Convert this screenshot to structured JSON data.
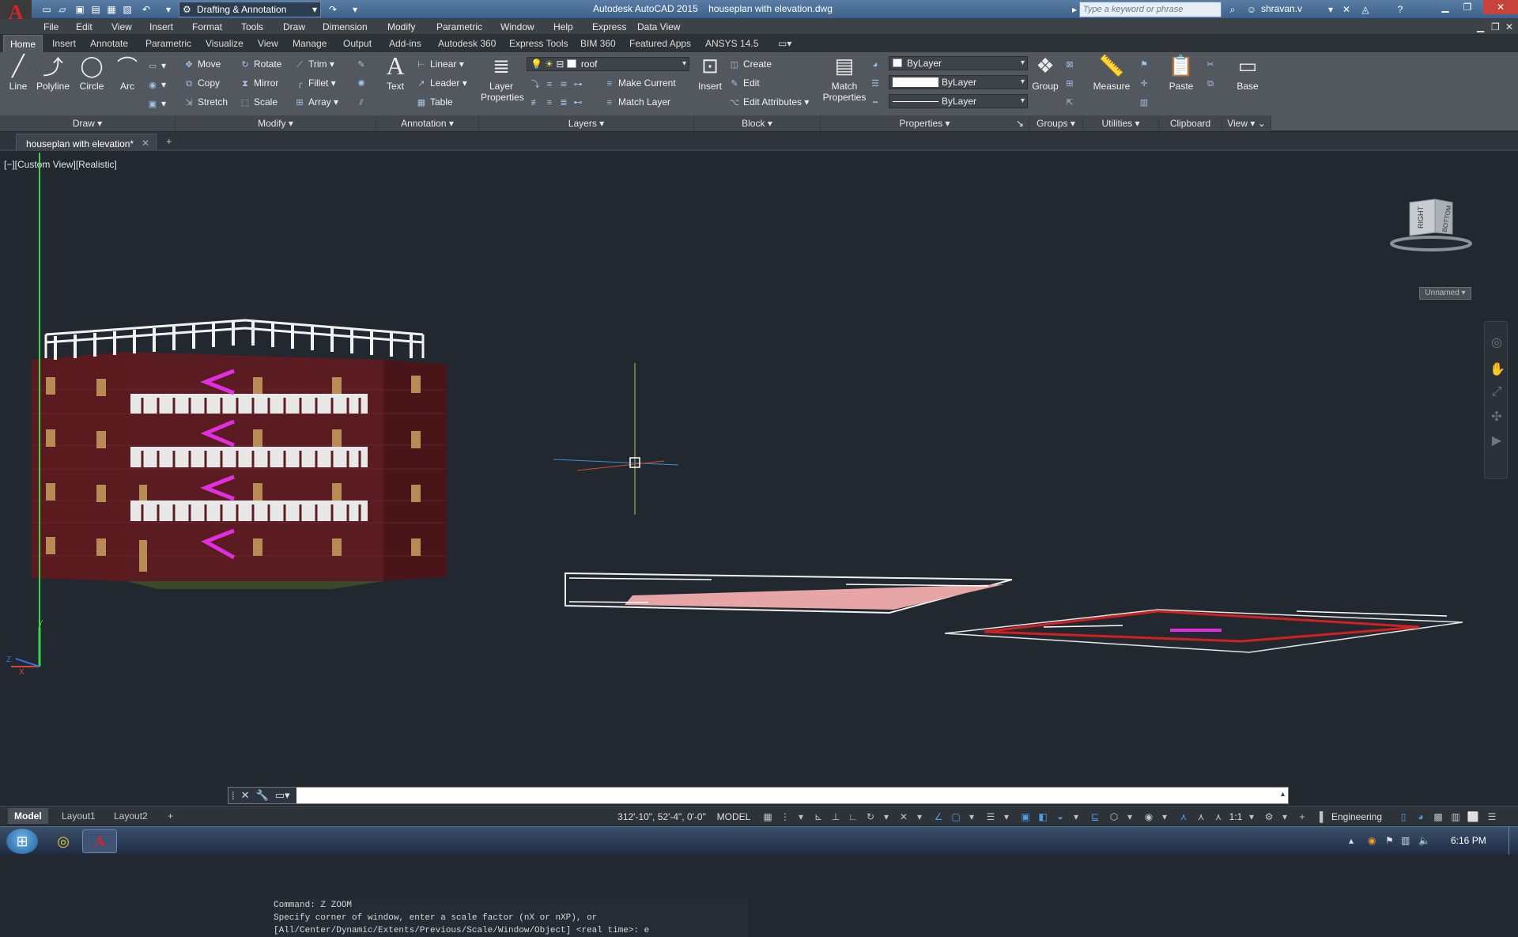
{
  "window": {
    "app_title": "Autodesk AutoCAD 2015",
    "file_title": "houseplan with elevation.dwg",
    "workspace": "Drafting & Annotation",
    "search_placeholder": "Type a keyword or phrase",
    "user": "shravan.v"
  },
  "menu": [
    "File",
    "Edit",
    "View",
    "Insert",
    "Format",
    "Tools",
    "Draw",
    "Dimension",
    "Modify",
    "Parametric",
    "Window",
    "Help",
    "Express",
    "Data View"
  ],
  "ribbon_tabs": [
    "Home",
    "Insert",
    "Annotate",
    "Parametric",
    "Visualize",
    "View",
    "Manage",
    "Output",
    "Add-ins",
    "Autodesk 360",
    "Express Tools",
    "BIM 360",
    "Featured Apps",
    "ANSYS 14.5"
  ],
  "active_ribbon_tab": "Home",
  "draw_panel": {
    "title": "Draw",
    "line": "Line",
    "polyline": "Polyline",
    "circle": "Circle",
    "arc": "Arc"
  },
  "modify_panel": {
    "title": "Modify",
    "move": "Move",
    "rotate": "Rotate",
    "trim": "Trim",
    "copy": "Copy",
    "mirror": "Mirror",
    "fillet": "Fillet",
    "stretch": "Stretch",
    "scale": "Scale",
    "array": "Array"
  },
  "annotation_panel": {
    "title": "Annotation",
    "text": "Text",
    "linear": "Linear",
    "leader": "Leader",
    "table": "Table"
  },
  "layers_panel": {
    "title": "Layers",
    "layer_properties": "Layer Properties",
    "current_layer": "roof",
    "make_current": "Make Current",
    "match_layer": "Match Layer"
  },
  "block_panel": {
    "title": "Block",
    "insert": "Insert",
    "create": "Create",
    "edit": "Edit",
    "edit_attributes": "Edit Attributes"
  },
  "properties_panel": {
    "title": "Properties",
    "match_properties": "Match Properties",
    "color": "ByLayer",
    "lineweight": "ByLayer",
    "linetype": "ByLayer"
  },
  "groups_panel": {
    "title": "Groups",
    "group": "Group"
  },
  "utilities_panel": {
    "title": "Utilities",
    "measure": "Measure"
  },
  "clipboard_panel": {
    "title": "Clipboard",
    "paste": "Paste"
  },
  "view_panel": {
    "title": "View",
    "base": "Base"
  },
  "document_tab": "houseplan with elevation*",
  "viewport": {
    "view_label": "[−][Custom View][Realistic]",
    "viewcube_face_right": "RIGHT",
    "viewcube_face_bottom": "BOTTOM",
    "ucs_label": "Unnamed"
  },
  "command": {
    "history": [
      "Command: Z ZOOM",
      "Specify corner of window, enter a scale factor (nX or nXP), or",
      "[All/Center/Dynamic/Extents/Previous/Scale/Window/Object] <real time>: e"
    ],
    "input": ""
  },
  "layout_tabs": [
    "Model",
    "Layout1",
    "Layout2"
  ],
  "active_layout": "Model",
  "status": {
    "coordinates": "312'-10\", 52'-4\", 0'-0\"",
    "space": "MODEL",
    "scale": "1:1",
    "units": "Engineering"
  },
  "taskbar": {
    "time": "6:16 PM"
  },
  "colors": {
    "viewport_bg": "#212830",
    "ribbon_bg": "#53585f",
    "title_blue": "#4a6d96",
    "brick": "#5a1a1e",
    "stair_magenta": "#e02ee0"
  }
}
